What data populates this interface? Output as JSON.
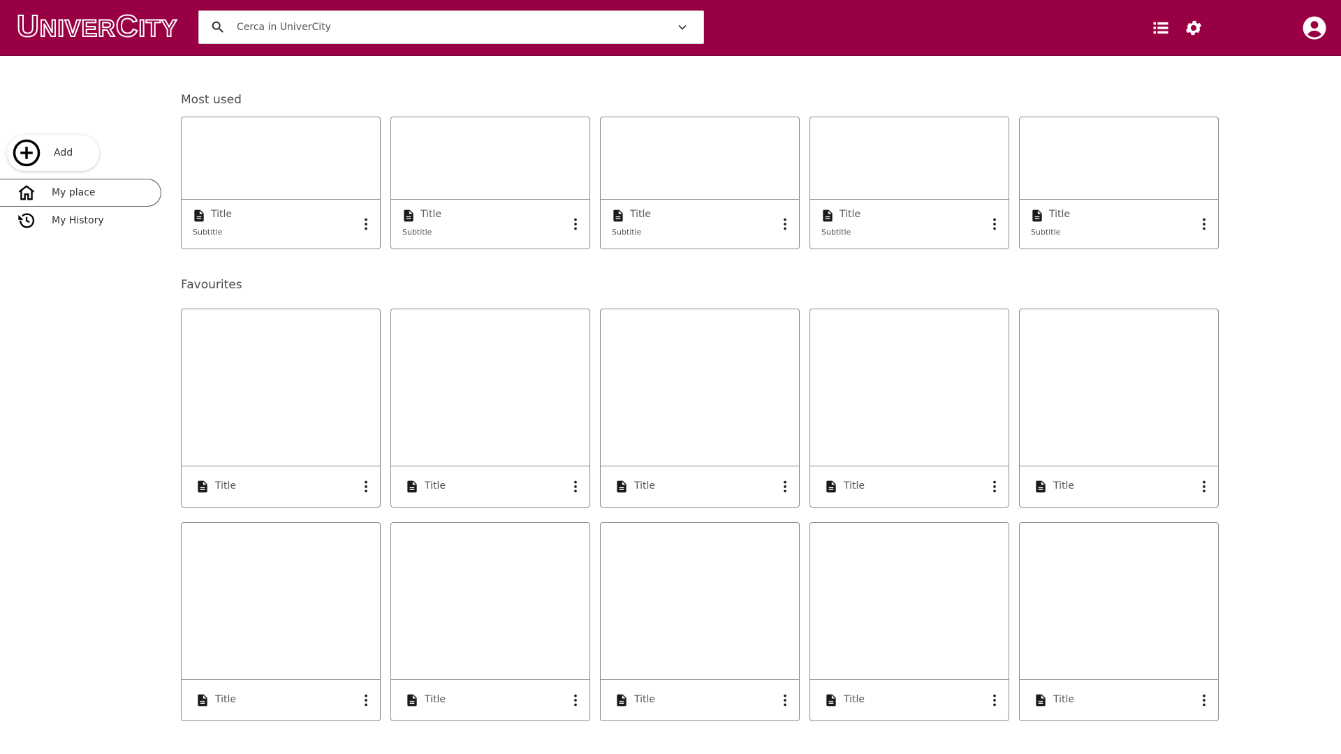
{
  "header": {
    "logo_text": "UniverCity",
    "search_placeholder": "Cerca in UniverCity",
    "brand_color": "#990044",
    "icons": [
      "search-icon",
      "chevron-down-icon",
      "list-icon",
      "gear-icon",
      "account-icon"
    ]
  },
  "sidebar": {
    "add_label": "Add",
    "items": [
      {
        "label": "My place",
        "icon": "home-icon",
        "active": true
      },
      {
        "label": "My History",
        "icon": "history-icon",
        "active": false
      }
    ]
  },
  "most_used": {
    "title": "Most used",
    "cards": [
      {
        "title": "Title",
        "subtitle": "Subtitle"
      },
      {
        "title": "Title",
        "subtitle": "Subtitle"
      },
      {
        "title": "Title",
        "subtitle": "Subtitle"
      },
      {
        "title": "Title",
        "subtitle": "Subtitle"
      },
      {
        "title": "Title",
        "subtitle": "Subtitle"
      }
    ]
  },
  "favourites": {
    "title": "Favourites",
    "cards": [
      {
        "title": "Title"
      },
      {
        "title": "Title"
      },
      {
        "title": "Title"
      },
      {
        "title": "Title"
      },
      {
        "title": "Title"
      },
      {
        "title": "Title"
      },
      {
        "title": "Title"
      },
      {
        "title": "Title"
      },
      {
        "title": "Title"
      },
      {
        "title": "Title"
      }
    ]
  }
}
